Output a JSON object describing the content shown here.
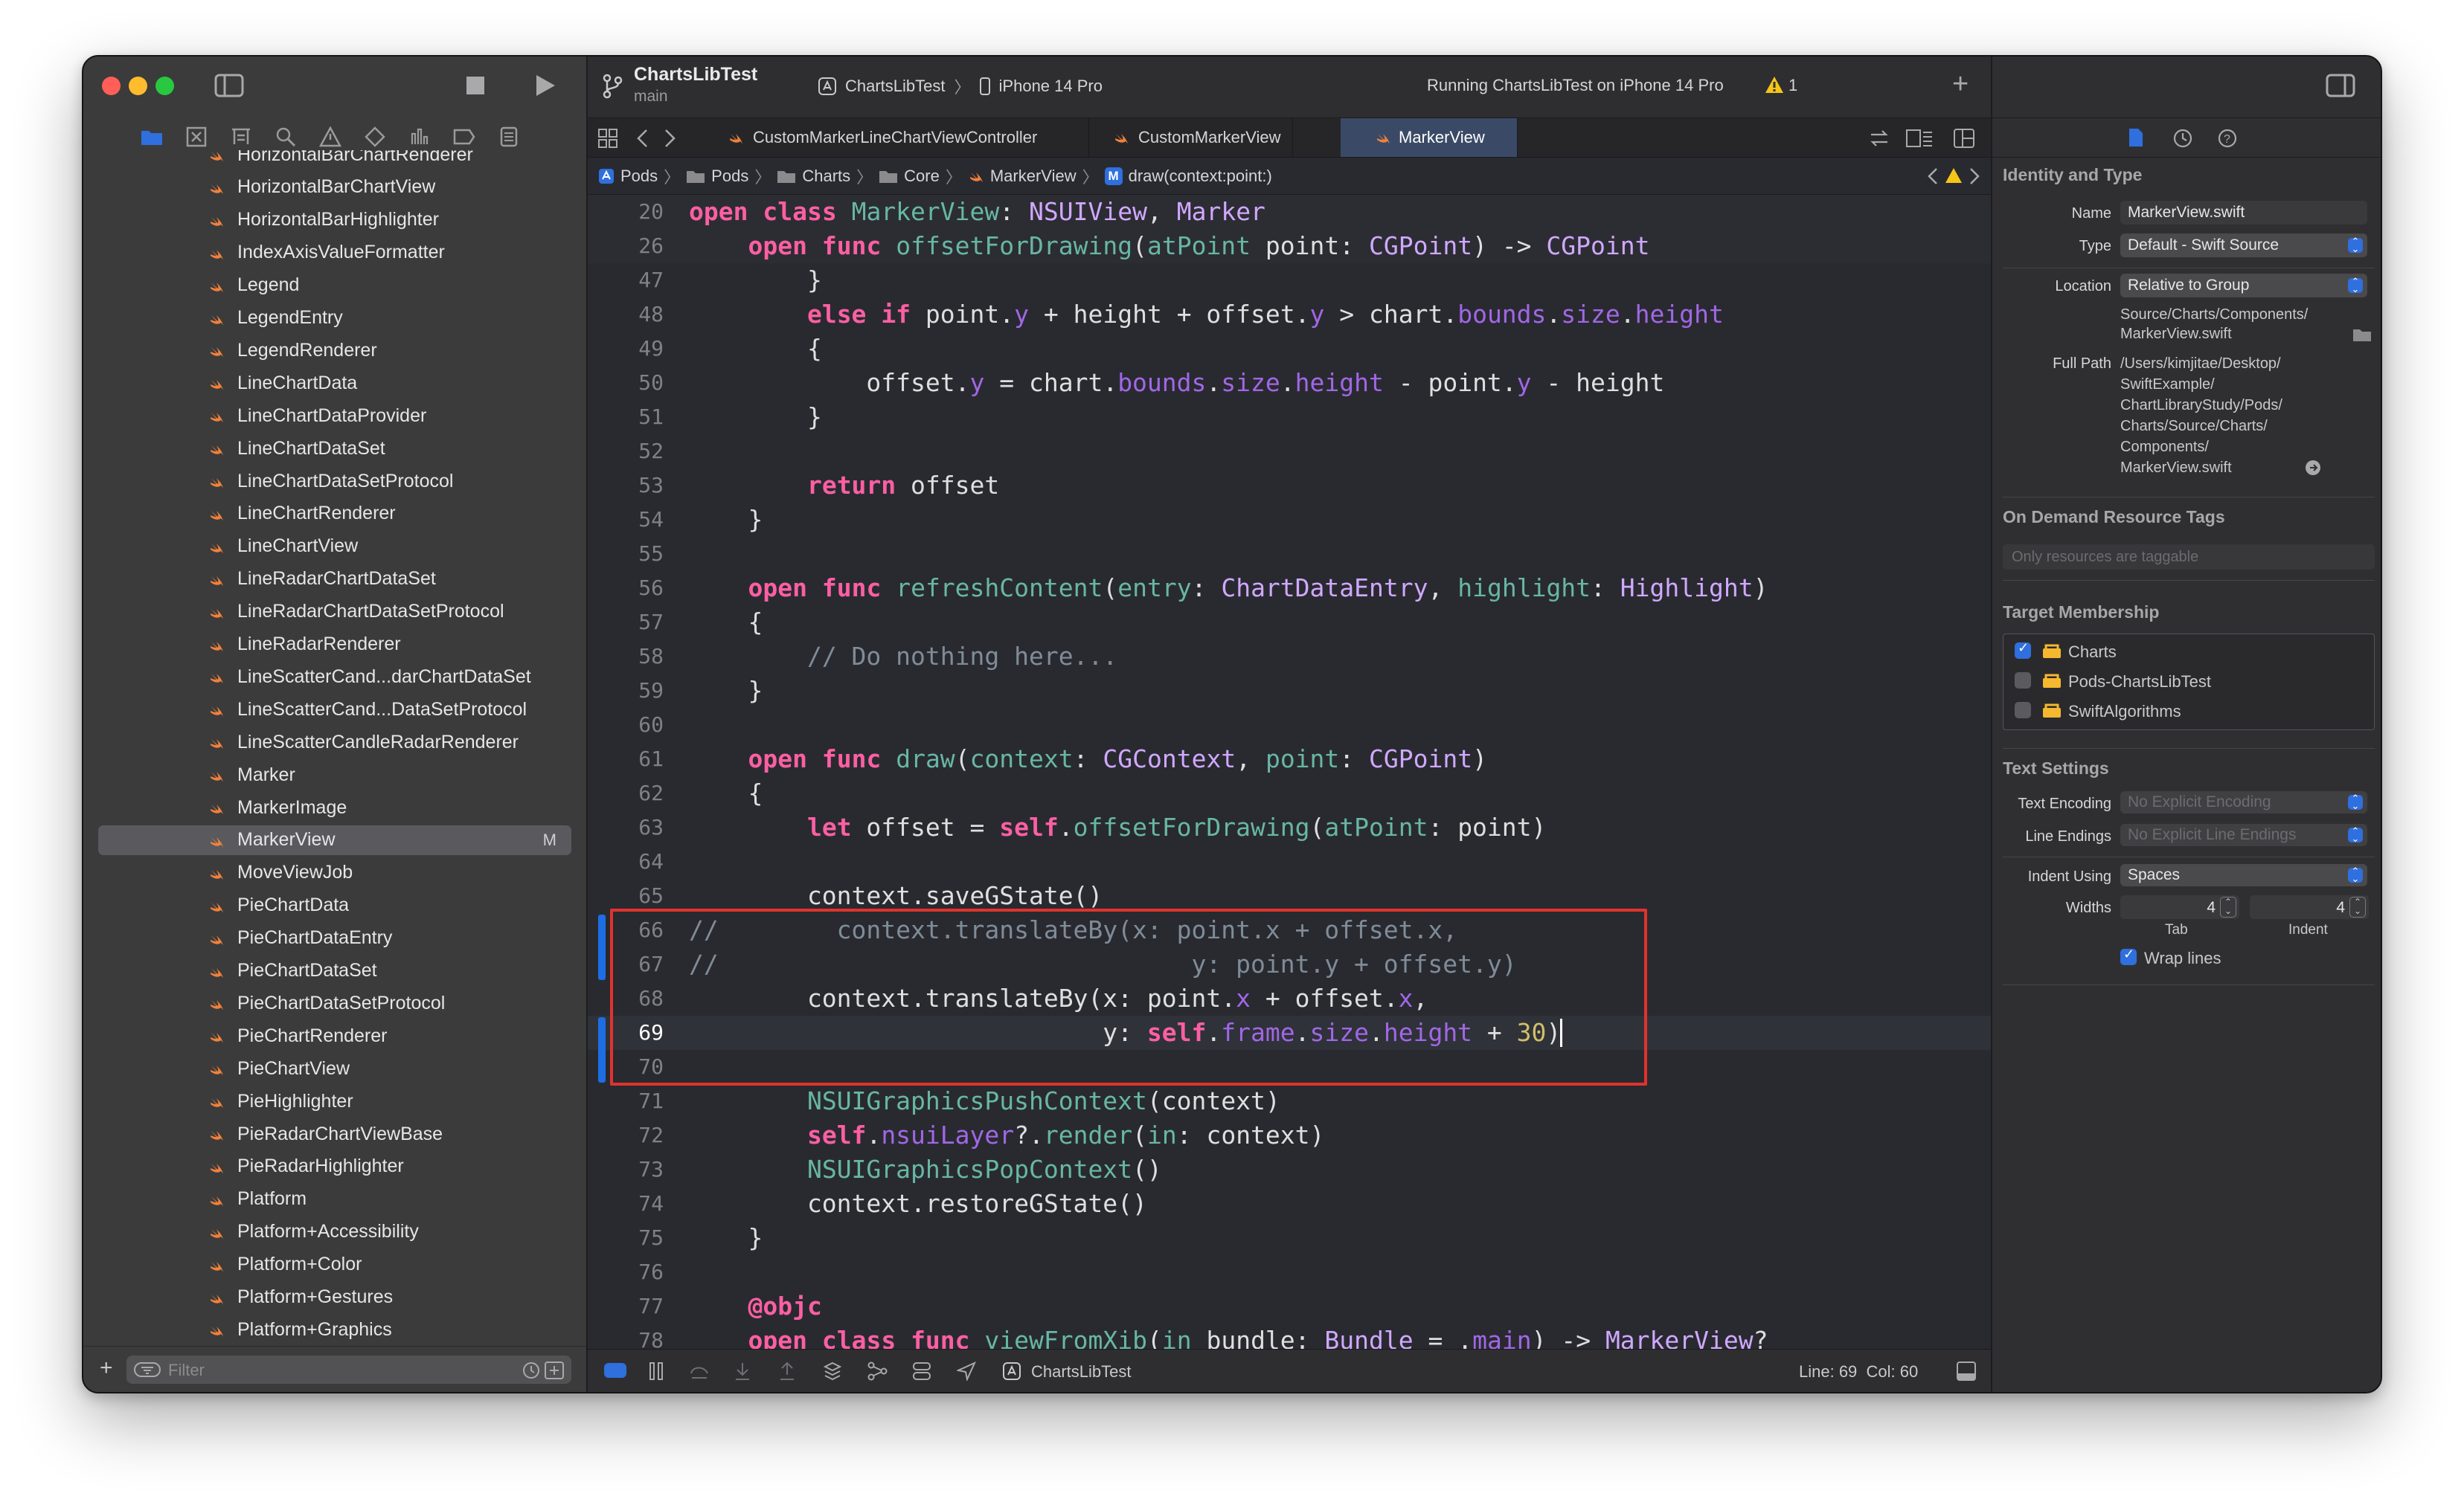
{
  "window": {
    "project": "ChartsLibTest",
    "branch": "main",
    "scheme": "ChartsLibTest",
    "device": "iPhone 14 Pro",
    "status": "Running ChartsLibTest on iPhone 14 Pro",
    "warning_count": "1"
  },
  "navigator": {
    "filter_placeholder": "Filter",
    "files": [
      {
        "name": "HorizontalBarChartRenderer",
        "badge": ""
      },
      {
        "name": "HorizontalBarChartView",
        "badge": ""
      },
      {
        "name": "HorizontalBarHighlighter",
        "badge": ""
      },
      {
        "name": "IndexAxisValueFormatter",
        "badge": ""
      },
      {
        "name": "Legend",
        "badge": ""
      },
      {
        "name": "LegendEntry",
        "badge": ""
      },
      {
        "name": "LegendRenderer",
        "badge": ""
      },
      {
        "name": "LineChartData",
        "badge": ""
      },
      {
        "name": "LineChartDataProvider",
        "badge": ""
      },
      {
        "name": "LineChartDataSet",
        "badge": ""
      },
      {
        "name": "LineChartDataSetProtocol",
        "badge": ""
      },
      {
        "name": "LineChartRenderer",
        "badge": ""
      },
      {
        "name": "LineChartView",
        "badge": ""
      },
      {
        "name": "LineRadarChartDataSet",
        "badge": ""
      },
      {
        "name": "LineRadarChartDataSetProtocol",
        "badge": ""
      },
      {
        "name": "LineRadarRenderer",
        "badge": ""
      },
      {
        "name": "LineScatterCand...darChartDataSet",
        "badge": ""
      },
      {
        "name": "LineScatterCand...DataSetProtocol",
        "badge": ""
      },
      {
        "name": "LineScatterCandleRadarRenderer",
        "badge": ""
      },
      {
        "name": "Marker",
        "badge": ""
      },
      {
        "name": "MarkerImage",
        "badge": ""
      },
      {
        "name": "MarkerView",
        "badge": "M",
        "selected": true
      },
      {
        "name": "MoveViewJob",
        "badge": ""
      },
      {
        "name": "PieChartData",
        "badge": ""
      },
      {
        "name": "PieChartDataEntry",
        "badge": ""
      },
      {
        "name": "PieChartDataSet",
        "badge": ""
      },
      {
        "name": "PieChartDataSetProtocol",
        "badge": ""
      },
      {
        "name": "PieChartRenderer",
        "badge": ""
      },
      {
        "name": "PieChartView",
        "badge": ""
      },
      {
        "name": "PieHighlighter",
        "badge": ""
      },
      {
        "name": "PieRadarChartViewBase",
        "badge": ""
      },
      {
        "name": "PieRadarHighlighter",
        "badge": ""
      },
      {
        "name": "Platform",
        "badge": ""
      },
      {
        "name": "Platform+Accessibility",
        "badge": ""
      },
      {
        "name": "Platform+Color",
        "badge": ""
      },
      {
        "name": "Platform+Gestures",
        "badge": ""
      },
      {
        "name": "Platform+Graphics",
        "badge": ""
      }
    ]
  },
  "editor": {
    "tabs": [
      {
        "label": "CustomMarkerLineChartViewController"
      },
      {
        "label": "CustomMarkerView"
      },
      {
        "label": "MarkerView"
      }
    ],
    "breadcrumb": [
      "Pods",
      "Pods",
      "Charts",
      "Core",
      "MarkerView",
      "draw(context:point:)"
    ],
    "lines": [
      {
        "n": "20",
        "html": "<span class=\"k\">open</span> <span class=\"k\">class</span> <span class=\"fn\">MarkerView</span>: <span class=\"ty\">NSUIView</span>, <span class=\"ty\">Marker</span>"
      },
      {
        "n": "26",
        "html": "    <span class=\"k\">open</span> <span class=\"k\">func</span> <span class=\"fn\">offsetForDrawing</span>(<span class=\"f\">atPoint</span> point: <span class=\"ty\">CGPoint</span>) -&gt; <span class=\"ty\">CGPoint</span>"
      },
      {
        "n": "47",
        "html": "        }"
      },
      {
        "n": "48",
        "html": "        <span class=\"k\">else</span> <span class=\"k\">if</span> point.<span class=\"p\">y</span> + height + offset.<span class=\"p\">y</span> &gt; chart.<span class=\"p\">bounds</span>.<span class=\"p\">size</span>.<span class=\"p\">height</span>"
      },
      {
        "n": "49",
        "html": "        {"
      },
      {
        "n": "50",
        "html": "            offset.<span class=\"p\">y</span> = chart.<span class=\"p\">bounds</span>.<span class=\"p\">size</span>.<span class=\"p\">height</span> - point.<span class=\"p\">y</span> - height"
      },
      {
        "n": "51",
        "html": "        }"
      },
      {
        "n": "52",
        "html": ""
      },
      {
        "n": "53",
        "html": "        <span class=\"k\">return</span> offset"
      },
      {
        "n": "54",
        "html": "    }"
      },
      {
        "n": "55",
        "html": ""
      },
      {
        "n": "56",
        "html": "    <span class=\"k\">open</span> <span class=\"k\">func</span> <span class=\"fn\">refreshContent</span>(<span class=\"f\">entry</span>: <span class=\"ty\">ChartDataEntry</span>, <span class=\"f\">highlight</span>: <span class=\"ty\">Highlight</span>)"
      },
      {
        "n": "57",
        "html": "    {"
      },
      {
        "n": "58",
        "html": "        <span class=\"c\">// Do nothing here...</span>"
      },
      {
        "n": "59",
        "html": "    }"
      },
      {
        "n": "60",
        "html": ""
      },
      {
        "n": "61",
        "html": "    <span class=\"k\">open</span> <span class=\"k\">func</span> <span class=\"fn\">draw</span>(<span class=\"f\">context</span>: <span class=\"ty\">CGContext</span>, <span class=\"f\">point</span>: <span class=\"ty\">CGPoint</span>)"
      },
      {
        "n": "62",
        "html": "    {"
      },
      {
        "n": "63",
        "html": "        <span class=\"k\">let</span> offset = <span class=\"k\">self</span>.<span class=\"fn\">offsetForDrawing</span>(<span class=\"f\">atPoint</span>: point)"
      },
      {
        "n": "64",
        "html": ""
      },
      {
        "n": "65",
        "html": "        context.saveGState()"
      },
      {
        "n": "66",
        "html": "<span class=\"c\">//        context.translateBy(x: point.x + offset.x,</span>"
      },
      {
        "n": "67",
        "html": "<span class=\"c\">//                                y: point.y + offset.y)</span>"
      },
      {
        "n": "68",
        "html": "        context.translateBy(x: point.<span class=\"p\">x</span> + offset.<span class=\"p\">x</span>,"
      },
      {
        "n": "69",
        "html": "                            y: <span class=\"k\">self</span>.<span class=\"p\">frame</span>.<span class=\"p\">size</span>.<span class=\"p\">height</span> + <span class=\"n\">30</span>)"
      },
      {
        "n": "70",
        "html": ""
      },
      {
        "n": "71",
        "html": "        <span class=\"fn\">NSUIGraphicsPushContext</span>(context)"
      },
      {
        "n": "72",
        "html": "        <span class=\"k\">self</span>.<span class=\"p\">nsuiLayer</span>?.<span class=\"fn\">render</span>(<span class=\"f\">in</span>: context)"
      },
      {
        "n": "73",
        "html": "        <span class=\"fn\">NSUIGraphicsPopContext</span>()"
      },
      {
        "n": "74",
        "html": "        context.restoreGState()"
      },
      {
        "n": "75",
        "html": "    }"
      },
      {
        "n": "76",
        "html": ""
      },
      {
        "n": "77",
        "html": "    <span class=\"k\">@objc</span>"
      },
      {
        "n": "78",
        "html": "    <span class=\"k\">open</span> <span class=\"k\">class</span> <span class=\"k\">func</span> <span class=\"fn\">viewFromXib</span>(<span class=\"f\">in</span> bundle: <span class=\"ty\">Bundle</span> = .<span class=\"p\">main</span>) -&gt; <span class=\"ty\">MarkerView</span>?"
      }
    ],
    "status_scheme": "ChartsLibTest",
    "cursor_pos": "Line: 69  Col: 60"
  },
  "inspector": {
    "identity_title": "Identity and Type",
    "name_label": "Name",
    "name_value": "MarkerView.swift",
    "type_label": "Type",
    "type_value": "Default - Swift Source",
    "location_label": "Location",
    "location_value": "Relative to Group",
    "location_path_1": "Source/Charts/Components/",
    "location_path_2": "MarkerView.swift",
    "fullpath_label": "Full Path",
    "fullpath_lines": [
      "/Users/kimjitae/Desktop/",
      "SwiftExample/",
      "ChartLibraryStudy/Pods/",
      "Charts/Source/Charts/",
      "Components/",
      "MarkerView.swift"
    ],
    "odr_title": "On Demand Resource Tags",
    "odr_placeholder": "Only resources are taggable",
    "target_title": "Target Membership",
    "targets": [
      {
        "name": "Charts",
        "checked": true
      },
      {
        "name": "Pods-ChartsLibTest",
        "checked": false
      },
      {
        "name": "SwiftAlgorithms",
        "checked": false
      }
    ],
    "text_title": "Text Settings",
    "encoding_label": "Text Encoding",
    "encoding_value": "No Explicit Encoding",
    "endings_label": "Line Endings",
    "endings_value": "No Explicit Line Endings",
    "indent_label": "Indent Using",
    "indent_value": "Spaces",
    "widths_label": "Widths",
    "tab_value": "4",
    "indent_value_num": "4",
    "tab_label": "Tab",
    "indent_label_small": "Indent",
    "wrap_label": "Wrap lines"
  },
  "colors": {
    "accent": "#2f6fde",
    "highlight_box": "#e0332d",
    "change_bar": "#1d6ee3"
  }
}
